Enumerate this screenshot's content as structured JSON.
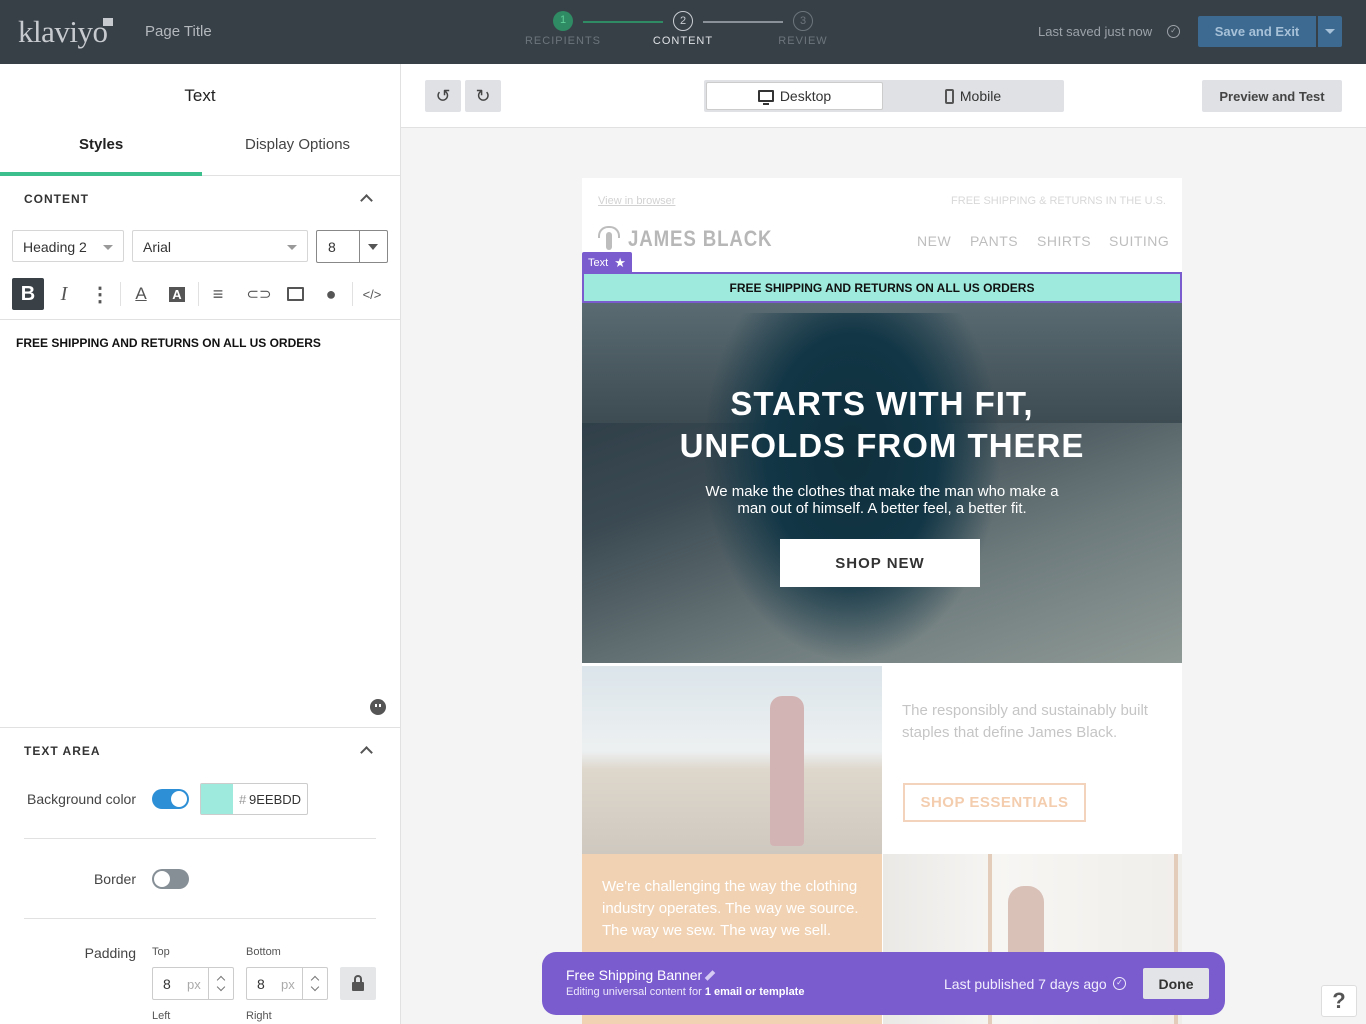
{
  "header": {
    "logo_text": "klaviyo",
    "page_title": "Page Title",
    "steps": [
      {
        "num": "1",
        "label": "RECIPIENTS"
      },
      {
        "num": "2",
        "label": "CONTENT"
      },
      {
        "num": "3",
        "label": "REVIEW"
      }
    ],
    "saved_status": "Last saved just now",
    "save_exit_label": "Save and Exit"
  },
  "left_panel": {
    "title": "Text",
    "tabs": [
      {
        "label": "Styles"
      },
      {
        "label": "Display Options"
      }
    ],
    "content_section": {
      "heading": "CONTENT",
      "style_select": "Heading 2",
      "font_select": "Arial",
      "font_size": "8",
      "editor_text": "FREE SHIPPING AND RETURNS ON ALL US ORDERS"
    },
    "text_area_section": {
      "heading": "TEXT AREA",
      "bg_color_label": "Background color",
      "bg_color_hash": "#",
      "bg_color_value": "9EEBDD",
      "border_label": "Border",
      "padding_label": "Padding",
      "top_label": "Top",
      "bottom_label": "Bottom",
      "left_label": "Left",
      "right_label": "Right",
      "top_value": "8",
      "bottom_value": "8",
      "unit": "px"
    }
  },
  "canvas_bar": {
    "desktop_label": "Desktop",
    "mobile_label": "Mobile",
    "preview_label": "Preview and Test"
  },
  "email": {
    "view_in_browser": "View in browser",
    "free_shipping_top": "FREE SHIPPING & RETURNS IN THE U.S.",
    "brand": "JAMES BLACK",
    "nav": [
      "NEW",
      "PANTS",
      "SHIRTS",
      "SUITING"
    ],
    "text_tag": "Text",
    "text_block": "FREE SHIPPING AND RETURNS ON ALL US ORDERS",
    "hero_line1": "STARTS WITH FIT,",
    "hero_line2": "UNFOLDS FROM THERE",
    "hero_sub": "We make the clothes that make the man who make a man out of himself. A better feel, a better fit.",
    "hero_button": "SHOP NEW",
    "block2_text": "The responsibly and sustainably built staples that define James Black.",
    "block2_button": "SHOP ESSENTIALS",
    "block3_text": "We're challenging the way the clothing industry operates. The way we source. The way we sew. The way we sell."
  },
  "banner": {
    "title": "Free Shipping Banner",
    "sub_prefix": "Editing universal content for ",
    "sub_bold": "1 email or template",
    "published": "Last published 7 days ago",
    "done_label": "Done"
  },
  "help_label": "?",
  "colors": {
    "accent_green": "#3cbf8c",
    "text_block_bg": "#9EEBDD",
    "selection_purple": "#7a5ccf",
    "save_button": "#3c6a91"
  }
}
